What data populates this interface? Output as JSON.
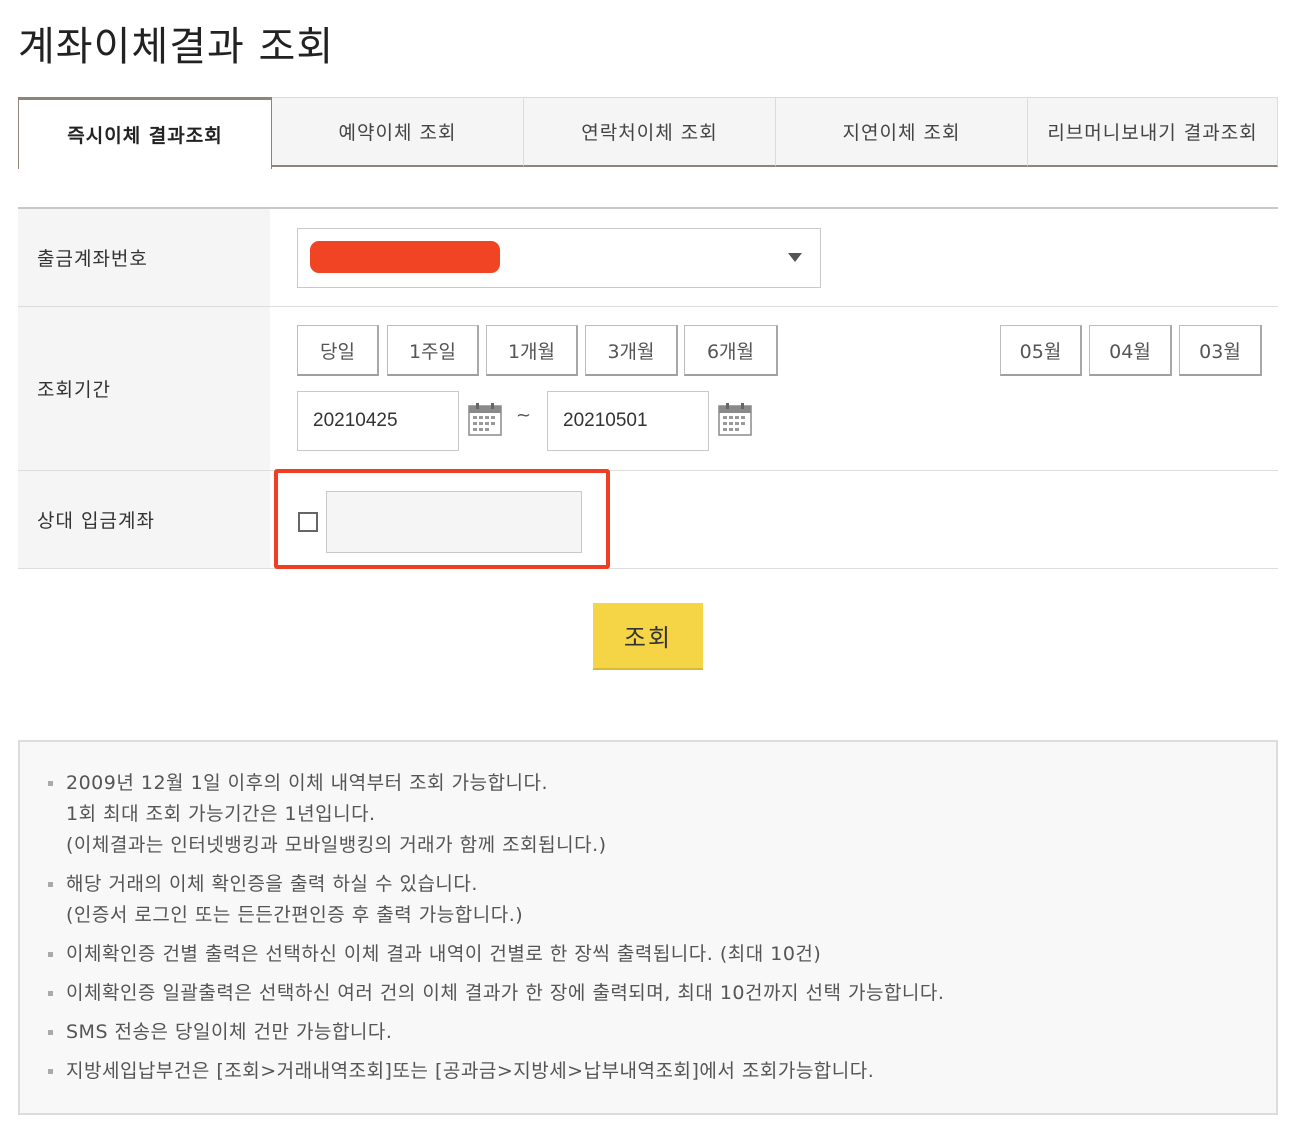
{
  "page": {
    "title": "계좌이체결과 조회"
  },
  "tabs": [
    {
      "label": "즉시이체 결과조회",
      "active": true
    },
    {
      "label": "예약이체 조회",
      "active": false
    },
    {
      "label": "연락처이체 조회",
      "active": false
    },
    {
      "label": "지연이체 조회",
      "active": false
    },
    {
      "label": "리브머니보내기 결과조회",
      "active": false
    }
  ],
  "form": {
    "account": {
      "label": "출금계좌번호"
    },
    "period": {
      "label": "조회기간",
      "quick_buttons": [
        "당일",
        "1주일",
        "1개월",
        "3개월",
        "6개월"
      ],
      "month_buttons": [
        "05월",
        "04월",
        "03월"
      ],
      "start_date": "20210425",
      "range_separator": "~",
      "end_date": "20210501"
    },
    "counterparty": {
      "label": "상대 입금계좌"
    }
  },
  "actions": {
    "search_label": "조회"
  },
  "notice": {
    "items": [
      [
        "2009년 12월 1일 이후의 이체 내역부터 조회 가능합니다.",
        "1회 최대 조회 가능기간은 1년입니다.",
        "(이체결과는 인터넷뱅킹과 모바일뱅킹의 거래가 함께 조회됩니다.)"
      ],
      [
        "해당 거래의 이체 확인증을 출력 하실 수 있습니다.",
        "(인증서 로그인 또는 든든간편인증 후 출력 가능합니다.)"
      ],
      [
        "이체확인증 건별 출력은 선택하신 이체 결과 내역이 건별로 한 장씩 출력됩니다. (최대 10건)"
      ],
      [
        "이체확인증 일괄출력은 선택하신 여러 건의 이체 결과가 한 장에 출력되며, 최대 10건까지 선택 가능합니다."
      ],
      [
        "SMS 전송은 당일이체 건만 가능합니다."
      ],
      [
        "지방세입납부건은 [조회>거래내역조회]또는 [공과금>지방세>납부내역조회]에서 조회가능합니다."
      ]
    ]
  },
  "colors": {
    "accent_yellow": "#f5d545",
    "highlight_red": "#ef3f22",
    "tab_border": "#8e8478"
  }
}
